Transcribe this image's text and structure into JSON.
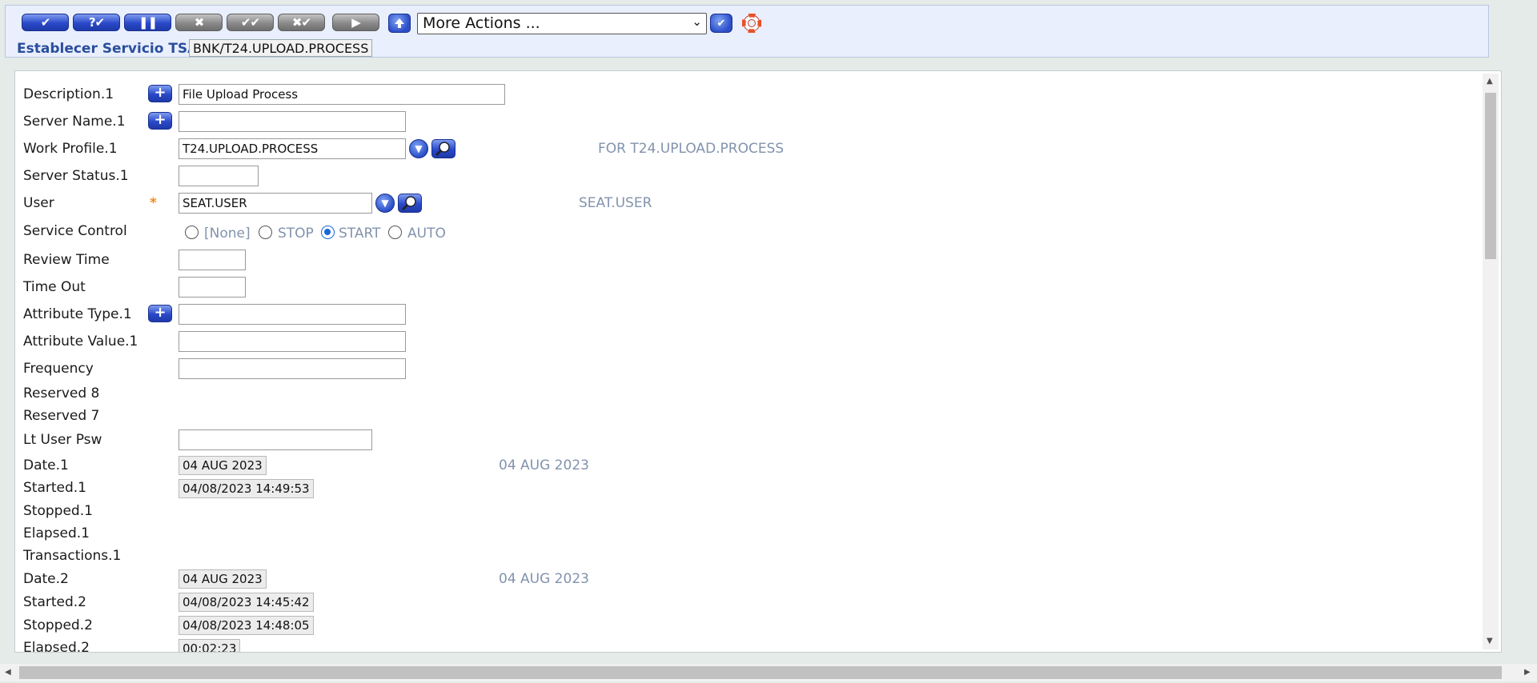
{
  "toolbar": {
    "buttons": [
      {
        "name": "commit-button",
        "glyph": "✔",
        "style": "blue"
      },
      {
        "name": "validate-button",
        "glyph": "?✔",
        "style": "blue"
      },
      {
        "name": "hold-button",
        "glyph": "❚❚",
        "style": "blue"
      },
      {
        "name": "delete-button",
        "glyph": "✖",
        "style": "gray"
      },
      {
        "name": "authorise-button",
        "glyph": "✔✔",
        "style": "gray"
      },
      {
        "name": "reverse-button",
        "glyph": "✖✔",
        "style": "gray"
      },
      {
        "name": "next-button",
        "glyph": "▶",
        "style": "gray"
      }
    ],
    "more_actions": "More Actions ...",
    "icons": {
      "upload": "upload-arrow-icon",
      "go": "checkmark-icon",
      "help": "lifebuoy-icon"
    }
  },
  "header": {
    "title": "Establecer Servicio TSA",
    "record_id": "BNK/T24.UPLOAD.PROCESS"
  },
  "form": {
    "description": {
      "label": "Description.1",
      "value": "File Upload Process"
    },
    "server_name": {
      "label": "Server Name.1",
      "value": ""
    },
    "work_profile": {
      "label": "Work Profile.1",
      "value": "T24.UPLOAD.PROCESS",
      "enrichment": "FOR T24.UPLOAD.PROCESS"
    },
    "server_status": {
      "label": "Server Status.1",
      "value": ""
    },
    "user": {
      "label": "User",
      "value": "SEAT.USER",
      "enrichment": "SEAT.USER",
      "required": "*"
    },
    "service_control": {
      "label": "Service Control",
      "options": [
        "[None]",
        "STOP",
        "START",
        "AUTO"
      ],
      "selected": "START"
    },
    "review_time": {
      "label": "Review Time",
      "value": ""
    },
    "time_out": {
      "label": "Time Out",
      "value": ""
    },
    "attribute_type": {
      "label": "Attribute Type.1",
      "value": ""
    },
    "attribute_value": {
      "label": "Attribute Value.1",
      "value": ""
    },
    "frequency": {
      "label": "Frequency",
      "value": ""
    },
    "reserved8": {
      "label": "Reserved 8"
    },
    "reserved7": {
      "label": "Reserved 7"
    },
    "lt_user_psw": {
      "label": "Lt User Psw",
      "value": ""
    },
    "date1": {
      "label": "Date.1",
      "value": "04 AUG 2023",
      "enrichment": "04 AUG 2023"
    },
    "started1": {
      "label": "Started.1",
      "value": "04/08/2023 14:49:53"
    },
    "stopped1": {
      "label": "Stopped.1"
    },
    "elapsed1": {
      "label": "Elapsed.1"
    },
    "transactions1": {
      "label": "Transactions.1"
    },
    "date2": {
      "label": "Date.2",
      "value": "04 AUG 2023",
      "enrichment": "04 AUG 2023"
    },
    "started2": {
      "label": "Started.2",
      "value": "04/08/2023 14:45:42"
    },
    "stopped2": {
      "label": "Stopped.2",
      "value": "04/08/2023 14:48:05"
    },
    "elapsed2": {
      "label": "Elapsed.2",
      "value": "00:02:23"
    }
  },
  "icons": {
    "expand": "plus-icon",
    "dropdown": "chevron-down-icon",
    "lookup": "magnifier-icon"
  }
}
